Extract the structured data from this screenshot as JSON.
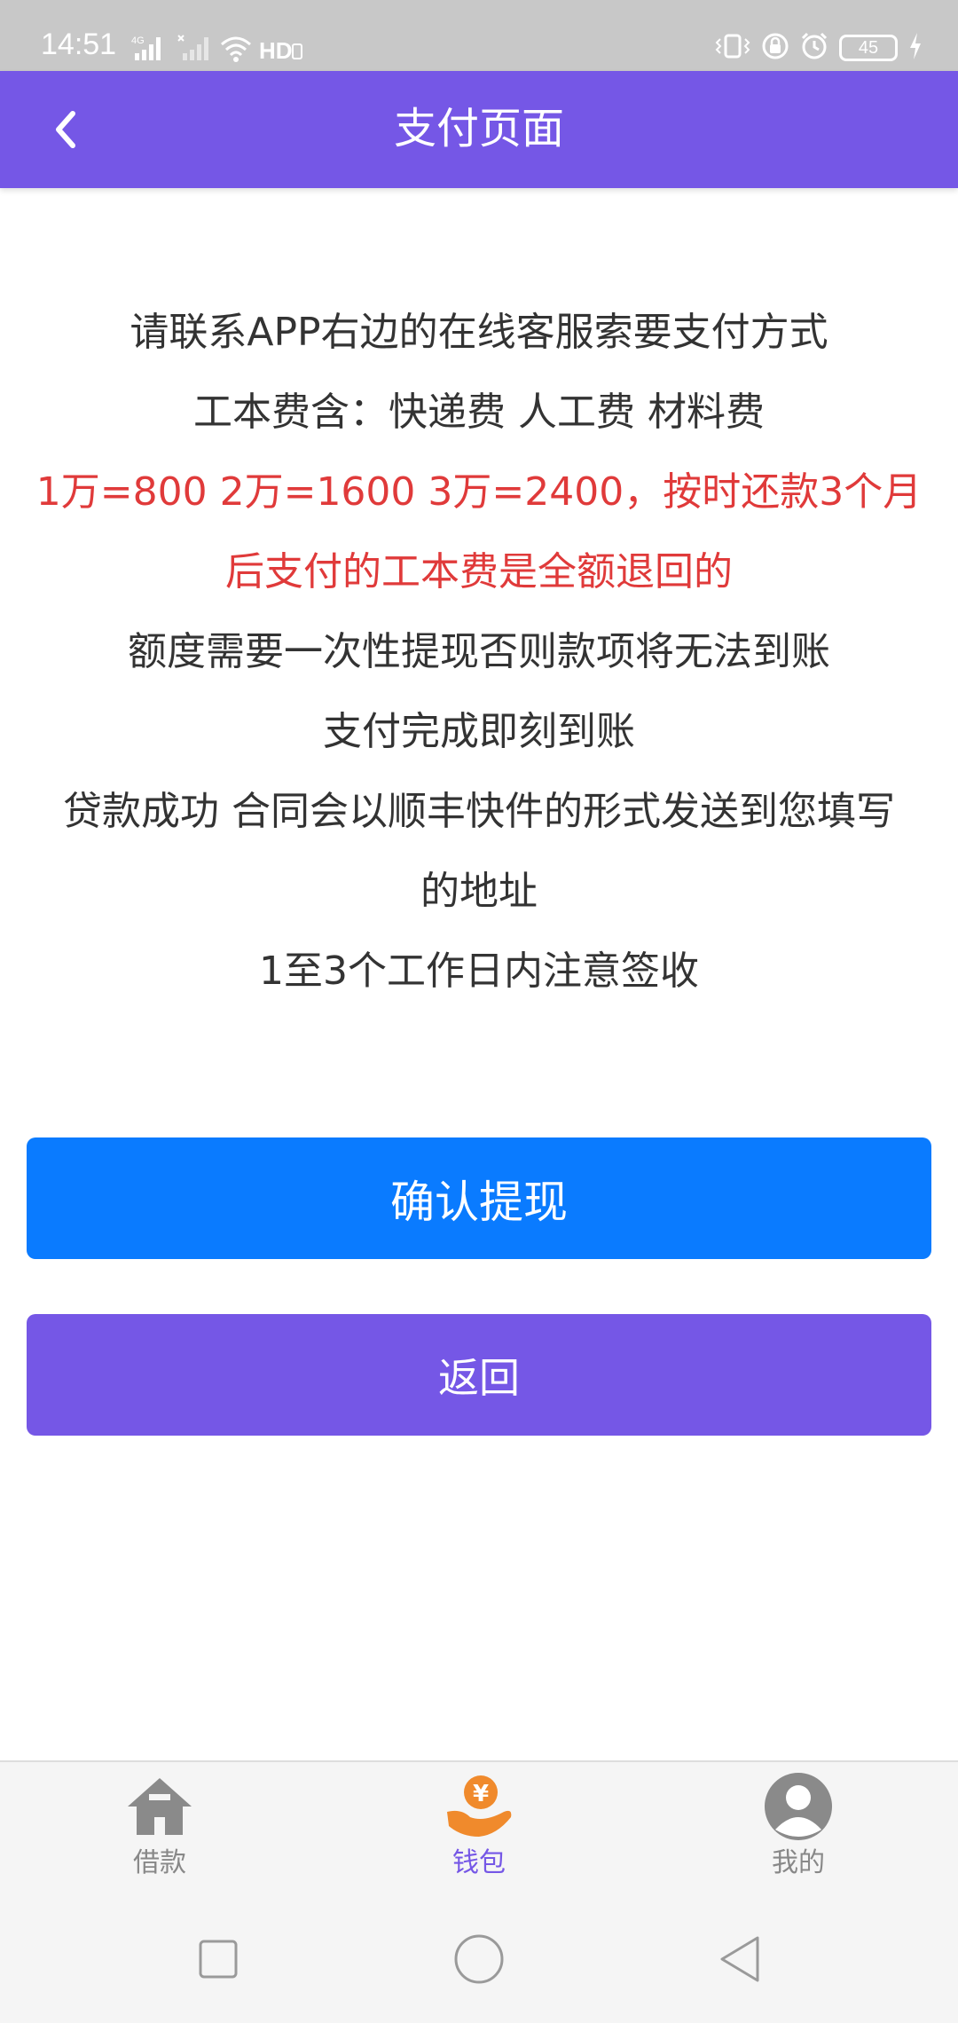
{
  "status_bar": {
    "time": "14:51",
    "network_label": "4G",
    "hd_label": "HD",
    "battery_level": "45",
    "colors": {
      "background": "#c8c8c8",
      "foreground": "#ffffff"
    }
  },
  "nav_bar": {
    "title": "支付页面",
    "back_icon": "chevron-left-icon",
    "color": "#7557e6"
  },
  "content": {
    "lines": [
      "请联系APP右边的在线客服索要支付方式",
      "工本费含：快递费 人工费 材料费"
    ],
    "highlight_lines": [
      "1万=800 2万=1600 3万=2400，按时还款3个月",
      "后支付的工本费是全额退回的"
    ],
    "more_lines": [
      "额度需要一次性提现否则款项将无法到账",
      "支付完成即刻到账",
      "贷款成功 合同会以顺丰快件的形式发送到您填写",
      "的地址",
      "1至3个工作日内注意签收"
    ],
    "highlight_color": "#e03a3a"
  },
  "buttons": {
    "confirm_label": "确认提现",
    "confirm_color": "#0a7bff",
    "back_label": "返回",
    "back_color": "#7557e6"
  },
  "tab_bar": {
    "tabs": [
      {
        "label": "借款",
        "icon": "house-icon",
        "active": false
      },
      {
        "label": "钱包",
        "icon": "wallet-yen-icon",
        "active": true
      },
      {
        "label": "我的",
        "icon": "user-avatar-icon",
        "active": false
      }
    ],
    "active_color": "#7557e6",
    "inactive_color": "#888888"
  },
  "system_nav": {
    "buttons": [
      "recent-apps-icon",
      "home-circle-icon",
      "back-triangle-icon"
    ]
  }
}
